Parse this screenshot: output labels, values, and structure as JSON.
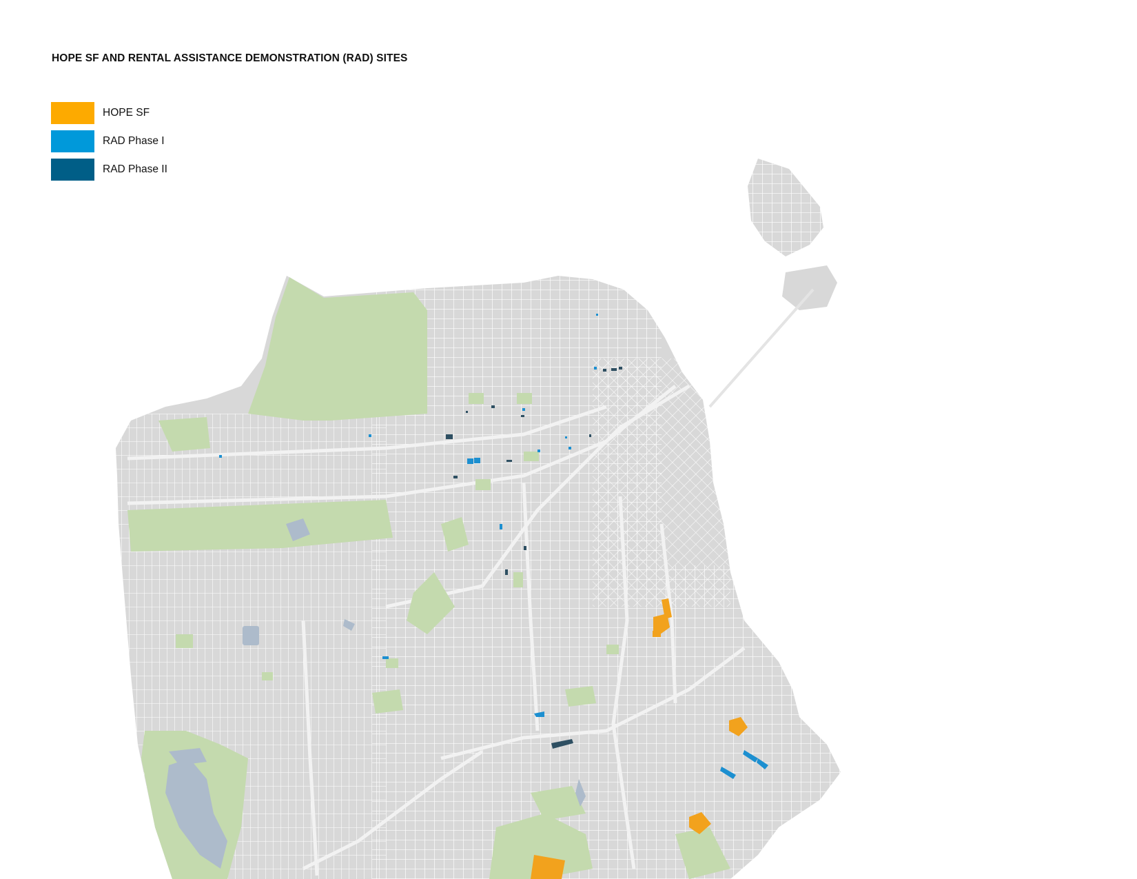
{
  "map": {
    "title": "HOPE SF AND RENTAL ASSISTANCE DEMONSTRATION (RAD) SITES",
    "legend": [
      {
        "label": "HOPE SF",
        "color": "#FDAA00"
      },
      {
        "label": "RAD Phase I",
        "color": "#0099DA"
      },
      {
        "label": "RAD Phase II",
        "color": "#005E87"
      }
    ],
    "colors": {
      "land": "#D8D8D8",
      "street": "#FFFFFF",
      "park": "#C4DAAE",
      "water": "#ADBBCB",
      "hope_sf": "#F2A21D",
      "rad_phase_1": "#1C8FD0",
      "rad_phase_2": "#2E4F62"
    }
  }
}
